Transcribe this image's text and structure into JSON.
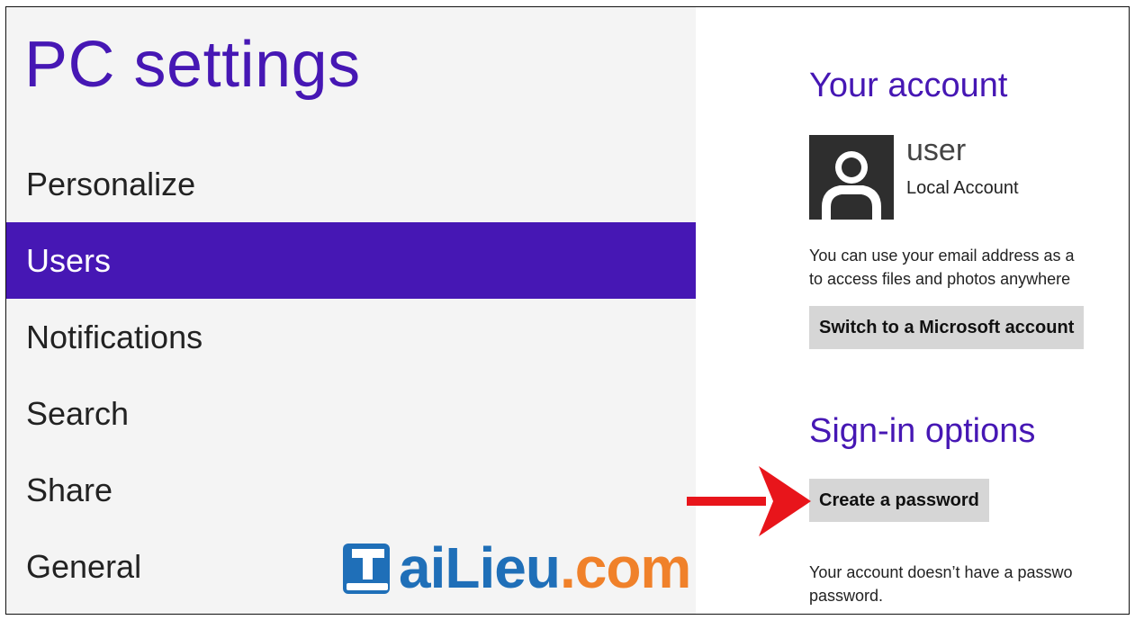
{
  "app": {
    "title": "PC settings"
  },
  "nav": {
    "items": [
      {
        "label": "Personalize",
        "selected": false
      },
      {
        "label": "Users",
        "selected": true
      },
      {
        "label": "Notifications",
        "selected": false
      },
      {
        "label": "Search",
        "selected": false
      },
      {
        "label": "Share",
        "selected": false
      },
      {
        "label": "General",
        "selected": false
      }
    ]
  },
  "account": {
    "section_title": "Your account",
    "user_name": "user",
    "account_type": "Local Account",
    "avatar_icon": "user-silhouette-icon",
    "info_line1": "You can use your email address as a",
    "info_line2": "to access files and photos anywhere",
    "switch_button": "Switch to a Microsoft account"
  },
  "signin": {
    "section_title": "Sign-in options",
    "create_password_button": "Create a password",
    "info_line1": "Your account doesn’t have a passwo",
    "info_line2": "password."
  },
  "annotation": {
    "arrow_icon": "red-arrow-right-icon",
    "arrow_color": "#e8151b"
  },
  "watermark": {
    "text_part1": "aiLieu",
    "text_part2": ".com",
    "icon": "book-t-logo-icon",
    "color_blue": "#1f6fb8",
    "color_orange": "#f0812a"
  },
  "colors": {
    "accent": "#4617b4",
    "left_pane_bg": "#f4f4f4",
    "button_bg": "#d6d6d6"
  }
}
